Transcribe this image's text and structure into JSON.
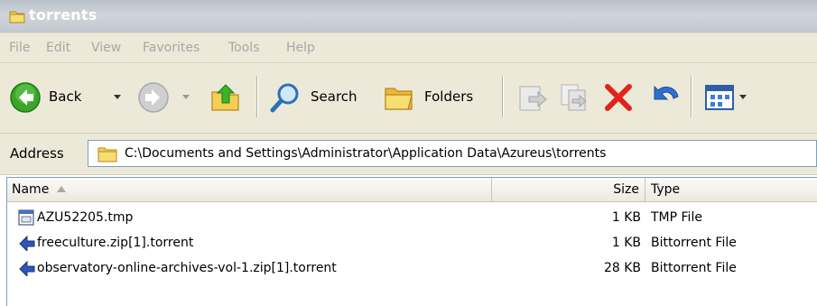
{
  "window": {
    "title": "torrents"
  },
  "menu": [
    {
      "label": "File"
    },
    {
      "label": "Edit"
    },
    {
      "label": "View"
    },
    {
      "label": "Favorites"
    },
    {
      "label": "Tools"
    },
    {
      "label": "Help"
    }
  ],
  "toolbar": {
    "back_label": "Back",
    "search_label": "Search",
    "folders_label": "Folders"
  },
  "address": {
    "label": "Address",
    "value": "C:\\Documents and Settings\\Administrator\\Application Data\\Azureus\\torrents"
  },
  "columns": {
    "name": "Name",
    "size": "Size",
    "type": "Type"
  },
  "files": [
    {
      "name": "AZU52205.tmp",
      "size": "1 KB",
      "type": "TMP File",
      "icon": "tmp-file-icon"
    },
    {
      "name": "freeculture.zip[1].torrent",
      "size": "1 KB",
      "type": "Bittorrent File",
      "icon": "torrent-file-icon"
    },
    {
      "name": "observatory-online-archives-vol-1.zip[1].torrent",
      "size": "28 KB",
      "type": "Bittorrent File",
      "icon": "torrent-file-icon"
    }
  ],
  "colors": {
    "titlebar_inactive": "#c2c8cf",
    "chrome": "#ece9d8",
    "back_green": "#3aa528",
    "delete_red": "#e3231a",
    "folder_yellow": "#f3cf52"
  }
}
